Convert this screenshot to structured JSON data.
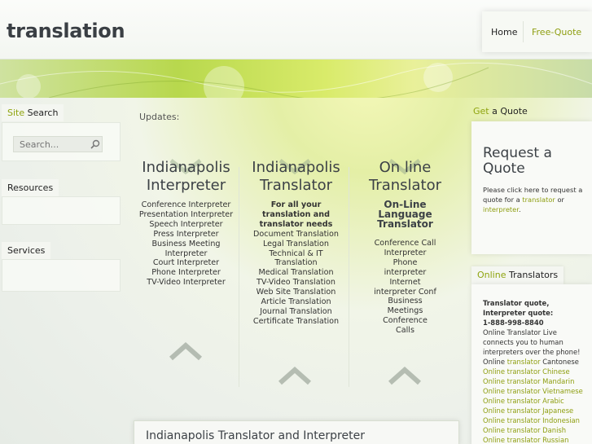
{
  "header": {
    "logo": "translation",
    "nav": {
      "home": "Home",
      "free_quote": "Free-Quote"
    }
  },
  "sidebar": {
    "search_label_hl": "Site",
    "search_label": " Search",
    "search_placeholder": "Search...",
    "resources_label": "Resources",
    "services_label": "Services"
  },
  "main": {
    "updates": "Updates:",
    "col1": {
      "title": "Indianapolis Interpreter",
      "items": [
        "Conference Interpreter",
        "Presentation Interpreter",
        "Speech Interpreter",
        "Press Interpreter",
        "Business Meeting Interpreter",
        "Court Interpreter",
        "Phone Interpreter",
        "TV-Video Interpreter"
      ]
    },
    "col2": {
      "title": "Indianapolis Translator",
      "bold": "For all your translation and translator needs",
      "items": [
        "Document Translation",
        "Legal Translation",
        "Technical & IT Translation",
        "Medical Translation",
        "TV-Video Translation",
        "Web Site Translation",
        "Article Translation",
        "Journal Translation",
        "Certificate Translation"
      ]
    },
    "col3": {
      "title": "On line Translator",
      "subtitle": "On-Line Language Translator",
      "items": [
        "Conference Call Interpreter",
        "Phone interpreter",
        "Internet interpreter Conf",
        "Business Meetings",
        "Conference Calls"
      ]
    },
    "bottom_title": "Indianapolis Translator and Interpreter"
  },
  "right": {
    "get_quote_hl": "Get",
    "get_quote": " a Quote",
    "request_title": "Request a Quote",
    "request_text_1": "Please click here to request a quote for a ",
    "request_link_1": "translator",
    "request_text_2": " or ",
    "request_link_2": "interpreter",
    "request_text_3": ".",
    "online_hl": "Online",
    "online": " Translators",
    "ot_bold_1": "Translator quote,",
    "ot_bold_2": "Interpreter quote:",
    "ot_phone": "1-888-998-8840",
    "ot_text": "Online Translator Live connects you to human interpreters over the phone!",
    "ot_cantonese_pre": "Online ",
    "ot_cantonese_link": "translator",
    "ot_cantonese_post": " Cantonese",
    "ot_links": [
      "Online translator Chinese",
      "Online translator Mandarin",
      "Online translator Vietnamese",
      "Online translator Arabic",
      "Online translator Japanese",
      "Online translator Indonesian",
      "Online translator Danish",
      "Online translator Russian"
    ]
  },
  "colors": {
    "accent": "#8e9e10",
    "text": "#3c4146"
  }
}
